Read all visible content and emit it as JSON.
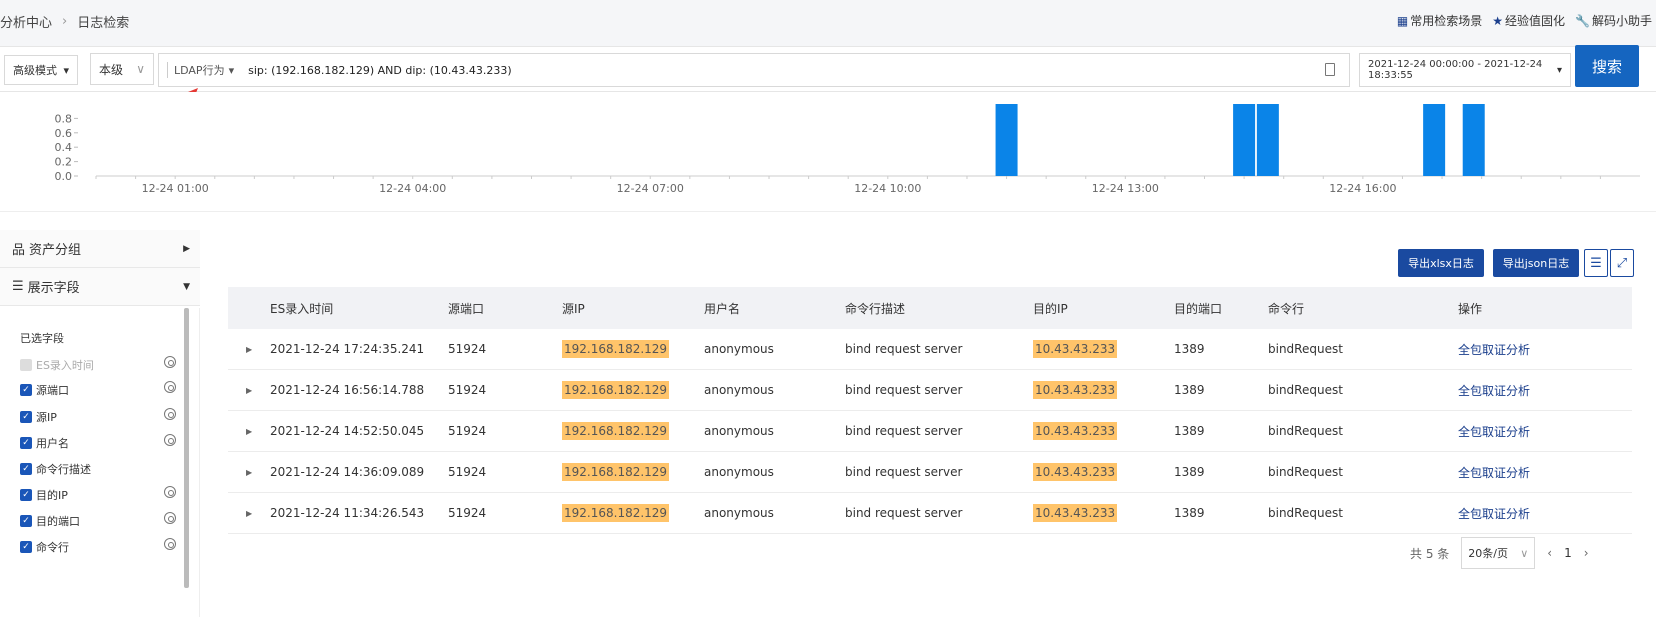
{
  "header": {
    "breadcrumb": [
      "分析中心",
      "日志检索"
    ],
    "links": [
      {
        "icon": "grid-icon",
        "label": "常用检索场景"
      },
      {
        "icon": "star-icon",
        "label": "经验值固化"
      },
      {
        "icon": "wrench-icon",
        "label": "解码小助手"
      }
    ]
  },
  "search": {
    "mode": "高级模式",
    "level": "本级",
    "ldap_tag": "LDAP行为",
    "query": "sip: (192.168.182.129) AND dip: (10.43.43.233)",
    "date_range": "2021-12-24 00:00:00 - 2021-12-24 18:33:55",
    "search_button": "搜索"
  },
  "chart_data": {
    "type": "bar",
    "y_ticks": [
      "0.0",
      "0.2",
      "0.4",
      "0.6",
      "0.8"
    ],
    "x_ticks": [
      "12-24 01:00",
      "12-24 04:00",
      "12-24 07:00",
      "12-24 10:00",
      "12-24 13:00",
      "12-24 16:00"
    ],
    "ylim": [
      0,
      1
    ],
    "bar_hours": [
      11.5,
      14.5,
      14.8,
      16.9,
      17.4
    ],
    "bar_values": [
      1,
      1,
      1,
      1,
      1
    ],
    "color": "#0a84e8"
  },
  "sidebar": {
    "asset_group": "资产分组",
    "display_fields": "展示字段",
    "selected_title": "已选字段",
    "fields": [
      {
        "label": "ES录入时间",
        "checked": false,
        "disabled": true,
        "eye": true
      },
      {
        "label": "源端口",
        "checked": true,
        "eye": true
      },
      {
        "label": "源IP",
        "checked": true,
        "eye": true
      },
      {
        "label": "用户名",
        "checked": true,
        "eye": true
      },
      {
        "label": "命令行描述",
        "checked": true,
        "eye": false
      },
      {
        "label": "目的IP",
        "checked": true,
        "eye": true
      },
      {
        "label": "目的端口",
        "checked": true,
        "eye": true
      },
      {
        "label": "命令行",
        "checked": true,
        "eye": true
      }
    ]
  },
  "actions": {
    "export_xlsx": "导出xlsx日志",
    "export_json": "导出json日志"
  },
  "table": {
    "columns": [
      "ES录入时间",
      "源端口",
      "源IP",
      "用户名",
      "命令行描述",
      "目的IP",
      "目的端口",
      "命令行",
      "操作"
    ],
    "rows": [
      [
        "2021-12-24 17:24:35.241",
        "51924",
        "192.168.182.129",
        "anonymous",
        "bind request server",
        "10.43.43.233",
        "1389",
        "bindRequest",
        "全包取证分析"
      ],
      [
        "2021-12-24 16:56:14.788",
        "51924",
        "192.168.182.129",
        "anonymous",
        "bind request server",
        "10.43.43.233",
        "1389",
        "bindRequest",
        "全包取证分析"
      ],
      [
        "2021-12-24 14:52:50.045",
        "51924",
        "192.168.182.129",
        "anonymous",
        "bind request server",
        "10.43.43.233",
        "1389",
        "bindRequest",
        "全包取证分析"
      ],
      [
        "2021-12-24 14:36:09.089",
        "51924",
        "192.168.182.129",
        "anonymous",
        "bind request server",
        "10.43.43.233",
        "1389",
        "bindRequest",
        "全包取证分析"
      ],
      [
        "2021-12-24 11:34:26.543",
        "51924",
        "192.168.182.129",
        "anonymous",
        "bind request server",
        "10.43.43.233",
        "1389",
        "bindRequest",
        "全包取证分析"
      ]
    ]
  },
  "pagination": {
    "total": "共 5 条",
    "page_size": "20条/页",
    "current_page": "1"
  }
}
